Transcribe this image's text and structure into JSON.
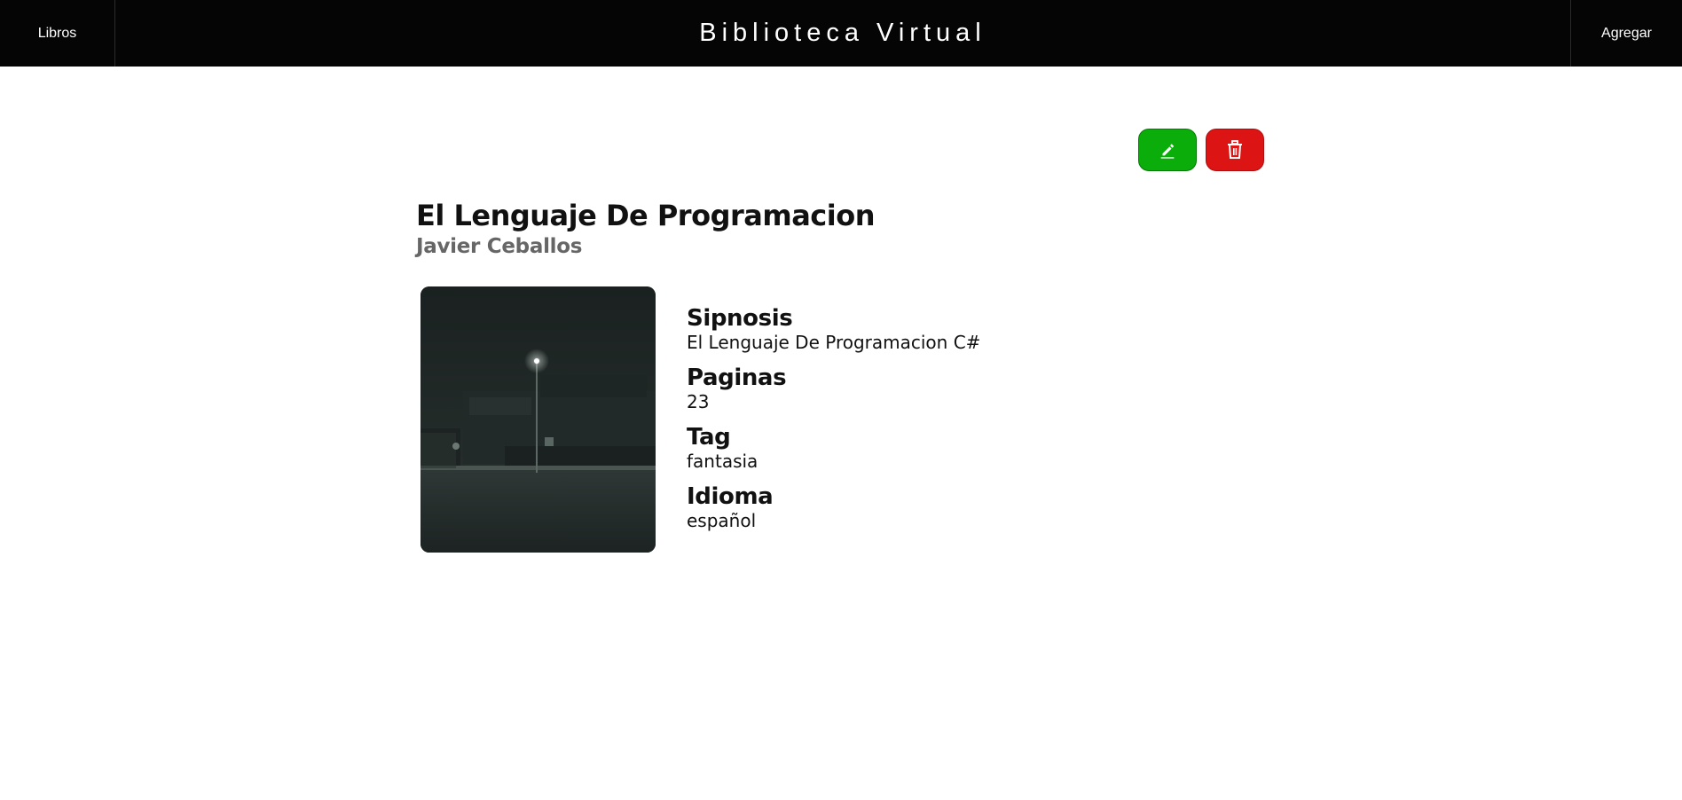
{
  "navbar": {
    "left_link": "Libros",
    "title": "Biblioteca Virtual",
    "right_link": "Agregar"
  },
  "actions": {
    "edit_icon": "pencil-icon",
    "delete_icon": "trash-icon",
    "edit_color": "#0aad0a",
    "delete_color": "#dc1414"
  },
  "book": {
    "title": "El Lenguaje De Programacion",
    "author": "Javier Ceballos",
    "details": [
      {
        "label": "Sipnosis",
        "value": "El Lenguaje De Programacion C#"
      },
      {
        "label": "Paginas",
        "value": "23"
      },
      {
        "label": "Tag",
        "value": "fantasia"
      },
      {
        "label": "Idioma",
        "value": "español"
      }
    ]
  }
}
